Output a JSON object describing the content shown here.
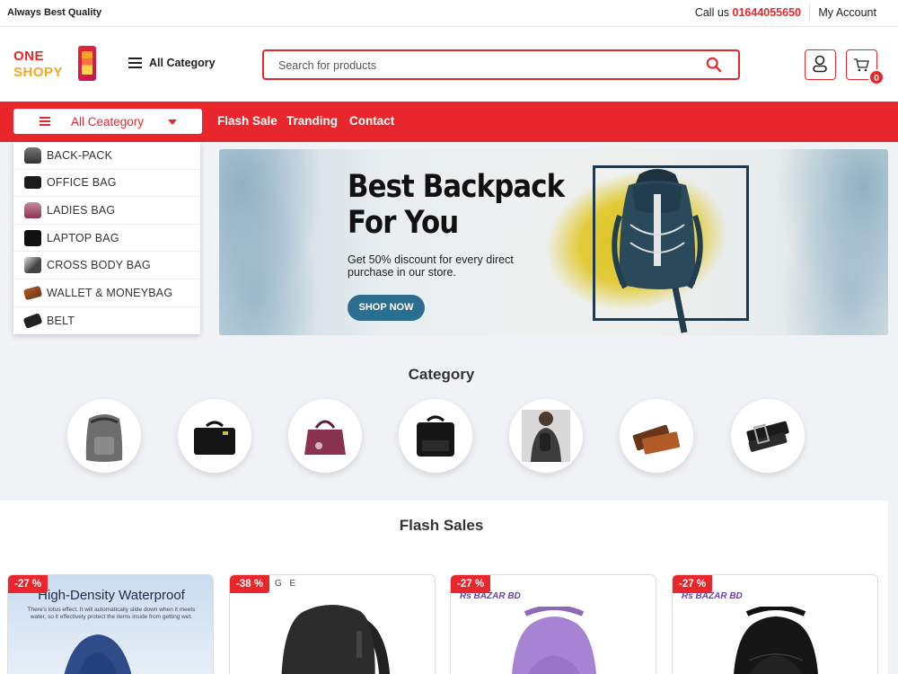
{
  "topbar": {
    "tagline": "Always Best Quality",
    "call_label": "Call us",
    "phone": "01644055650",
    "account": "My Account"
  },
  "header": {
    "logo_line1": "ONE",
    "logo_line2": "SHOPY",
    "all_category": "All Category",
    "search_placeholder": "Search for products",
    "cart_count": "0"
  },
  "nav": {
    "dropdown_label": "All Ceategory",
    "links": [
      "Flash Sale",
      "Tranding",
      "Contact"
    ]
  },
  "categories_menu": [
    {
      "label": "BACK-PACK",
      "icon": "backpack-thumb"
    },
    {
      "label": "OFFICE BAG",
      "icon": "office-bag-thumb"
    },
    {
      "label": "LADIES BAG",
      "icon": "ladies-bag-thumb"
    },
    {
      "label": "LAPTOP BAG",
      "icon": "laptop-bag-thumb"
    },
    {
      "label": "CROSS BODY BAG",
      "icon": "cross-body-bag-thumb"
    },
    {
      "label": "WALLET & MONEYBAG",
      "icon": "wallet-thumb"
    },
    {
      "label": "BELT",
      "icon": "belt-thumb"
    }
  ],
  "hero": {
    "title_line1": "Best Backpack",
    "title_line2": "For You",
    "subtitle": "Get 50% discount for every direct purchase in our store.",
    "cta": "SHOP NOW"
  },
  "category_section": {
    "title": "Category",
    "items": [
      "backpack",
      "office-bag",
      "ladies-bag",
      "laptop-bag",
      "cross-body-bag",
      "wallet",
      "belt"
    ]
  },
  "flash_sales": {
    "title": "Flash Sales",
    "products": [
      {
        "discount": "-27 %",
        "caption": "High-Density Waterproof",
        "caption_sub": "There's lotus effect. It will automatically slide down when it meets water, so it effectively protect the items inside from getting wet.",
        "color": "#2e4c8a"
      },
      {
        "discount": "-38 %",
        "caption": "",
        "brand_text": "G E",
        "color": "#2b2b2b"
      },
      {
        "discount": "-27 %",
        "brand_text": "Rs BAZAR BD",
        "color": "#a784d3"
      },
      {
        "discount": "-27 %",
        "brand_text": "Rs BAZAR BD",
        "color": "#1a1a1a"
      }
    ]
  },
  "colors": {
    "accent": "#e8262b",
    "hero_button": "#2c6e8f",
    "logo_orange": "#f5a623"
  }
}
